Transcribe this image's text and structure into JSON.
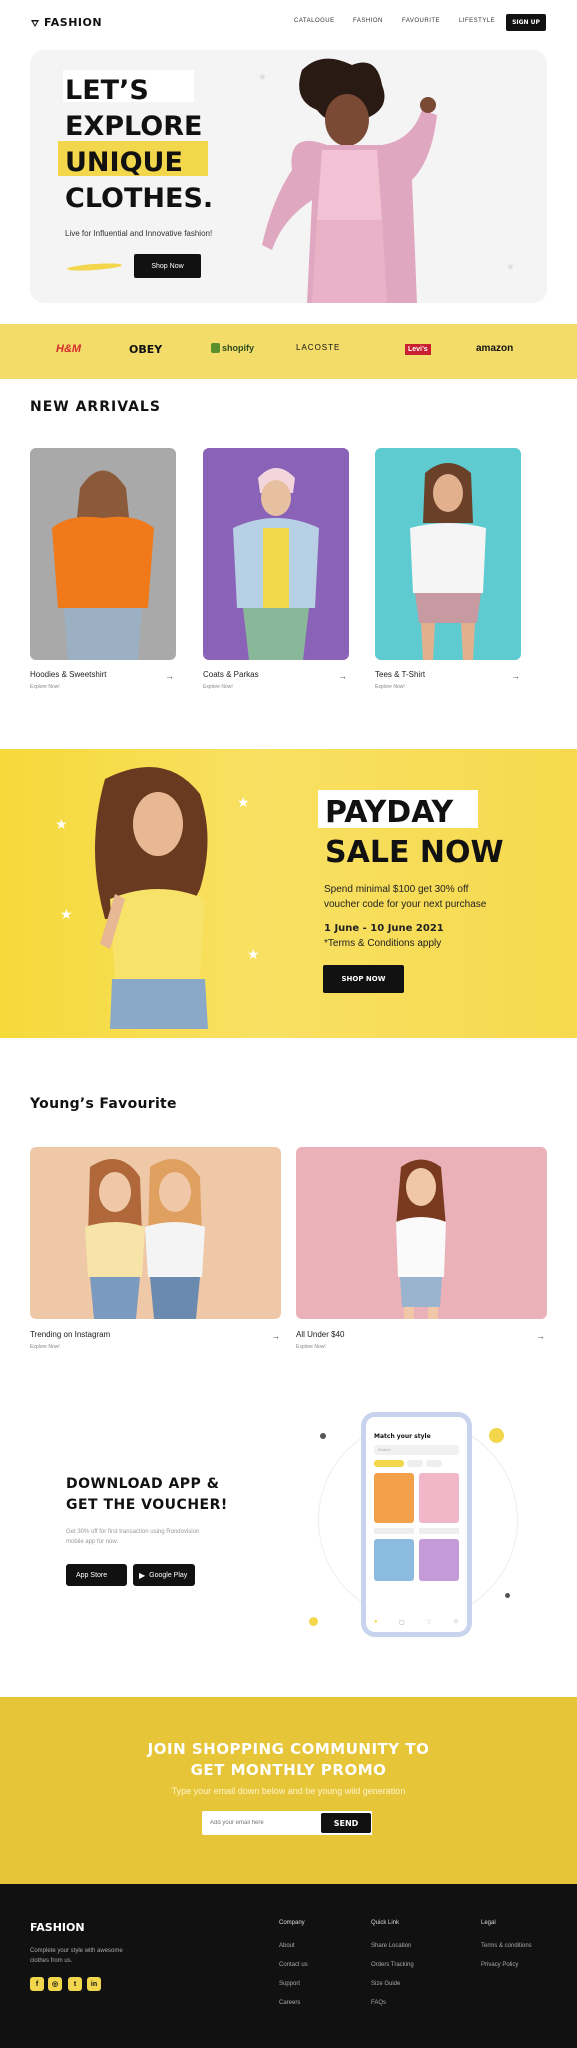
{
  "header": {
    "logo_text": "FASHION",
    "nav": [
      "CATALOGUE",
      "FASHION",
      "FAVOURITE",
      "LIFESTYLE"
    ],
    "signup_label": "SIGN UP"
  },
  "hero": {
    "title_lines": [
      "LET’S",
      "EXPLORE",
      "UNIQUE",
      "CLOTHES."
    ],
    "subtitle": "Live for Influential and Innovative fashion!",
    "button_label": "Shop Now"
  },
  "brands": [
    "H&M",
    "OBEY",
    "shopify",
    "LACOSTE",
    "Levi’s",
    "amazon"
  ],
  "new_arrivals": {
    "title": "NEW ARRIVALS",
    "cards": [
      {
        "label": "Hoodies & Sweetshirt",
        "sub": "Explore Now!"
      },
      {
        "label": "Coats & Parkas",
        "sub": "Explore Now!"
      },
      {
        "label": "Tees & T-Shirt",
        "sub": "Explore Now!"
      }
    ]
  },
  "payday": {
    "title_lines": [
      "PAYDAY",
      "SALE NOW"
    ],
    "desc_lines": [
      "Spend minimal $100 get 30% off",
      "voucher code for your next purchase"
    ],
    "dates": "1 June - 10 June 2021",
    "terms": "*Terms & Conditions apply",
    "button_label": "SHOP NOW"
  },
  "favourite": {
    "title": "Young’s Favourite",
    "cards": [
      {
        "label": "Trending on Instagram",
        "sub": "Explore Now!"
      },
      {
        "label": "All Under $40",
        "sub": "Explore Now!"
      }
    ]
  },
  "app": {
    "title_lines": [
      "DOWNLOAD APP &",
      "GET THE VOUCHER!"
    ],
    "desc": "Get 30% off for first transaction using Rondovision mobile app for now.",
    "stores": [
      "App Store",
      "Google Play"
    ],
    "phone": {
      "heading": "Match your style",
      "search_placeholder": "Search"
    }
  },
  "community": {
    "title_lines": [
      "JOIN SHOPPING COMMUNITY TO",
      "GET MONTHLY PROMO"
    ],
    "subtitle": "Type your email down below and be young wild generation",
    "email_placeholder": "Add your email here",
    "send_label": "SEND"
  },
  "footer": {
    "brand": "FASHION",
    "tagline_lines": [
      "Complete your style with awesome",
      "clothes from us."
    ],
    "columns": [
      {
        "heading": "Company",
        "links": [
          "About",
          "Contact us",
          "Support",
          "Careers"
        ]
      },
      {
        "heading": "Quick Link",
        "links": [
          "Share Location",
          "Orders Tracking",
          "Size Guide",
          "FAQs"
        ]
      },
      {
        "heading": "Legal",
        "links": [
          "Terms & conditions",
          "Privacy Policy"
        ]
      }
    ],
    "social_icons": [
      "facebook-icon",
      "instagram-icon",
      "twitter-icon",
      "linkedin-icon"
    ]
  },
  "colors": {
    "accent": "#f2d64b",
    "dark": "#111111"
  }
}
